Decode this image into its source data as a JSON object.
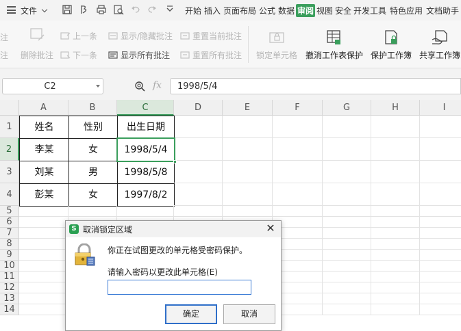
{
  "menubar": {
    "file_label": "文件",
    "tabs": [
      {
        "label": "开始",
        "active": false
      },
      {
        "label": "插入",
        "active": false
      },
      {
        "label": "页面布局",
        "active": false
      },
      {
        "label": "公式",
        "active": false
      },
      {
        "label": "数据",
        "active": false
      },
      {
        "label": "审阅",
        "active": true
      },
      {
        "label": "视图",
        "active": false
      },
      {
        "label": "安全",
        "active": false
      },
      {
        "label": "开发工具",
        "active": false
      },
      {
        "label": "特色应用",
        "active": false
      },
      {
        "label": "文档助手",
        "active": false
      }
    ]
  },
  "ribbon": {
    "cut_left_1": "注",
    "cut_left_2": "注",
    "delete_comment": "删除批注",
    "prev_comment": "上一条",
    "next_comment": "下一条",
    "show_hide_comment": "显示/隐藏批注",
    "show_all_comments": "显示所有批注",
    "reset_current_comment": "重置当前批注",
    "reset_all_comments": "重置所有批注",
    "lock_cell": "锁定单元格",
    "unprotect_sheet": "撤消工作表保护",
    "protect_workbook": "保护工作簿",
    "share_workbook": "共享工作簿"
  },
  "formula_bar": {
    "name_box": "C2",
    "fx_label": "fx",
    "value": "1998/5/4"
  },
  "sheet": {
    "columns": [
      "A",
      "B",
      "C",
      "D",
      "E",
      "F",
      "G",
      "H",
      "I"
    ],
    "selected_column": "C",
    "rows": [
      "1",
      "2",
      "3",
      "4",
      "5",
      "6",
      "7",
      "8",
      "9",
      "10",
      "11",
      "12",
      "13",
      "14"
    ],
    "selected_row": "2",
    "cells": {
      "A1": "姓名",
      "B1": "性别",
      "C1": "出生日期",
      "A2": "李某",
      "B2": "女",
      "C2": "1998/5/4",
      "A3": "刘某",
      "B3": "男",
      "C3": "1998/5/8",
      "A4": "彭某",
      "B4": "女",
      "C4": "1997/8/2"
    }
  },
  "dialog": {
    "logo": "S",
    "title": "取消锁定区域",
    "close": "✕",
    "message": "你正在试图更改的单元格受密码保护。",
    "prompt": "请输入密码以更改此单元格(E)",
    "password_value": "",
    "ok_label": "确定",
    "cancel_label": "取消"
  },
  "colors": {
    "accent": "#3a9e5c",
    "dialog_focus": "#2f6fc9"
  }
}
